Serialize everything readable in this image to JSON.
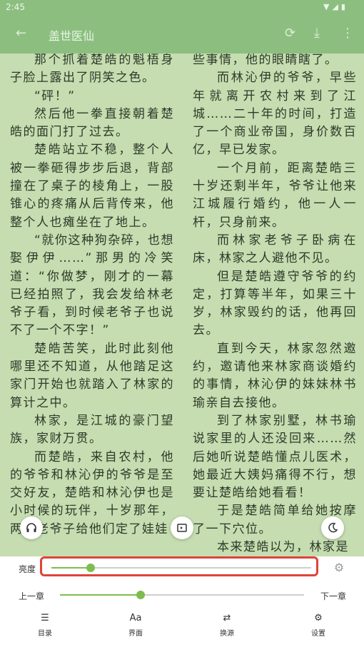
{
  "status": {
    "time": "2:45"
  },
  "topbar": {
    "back_icon": "back-arrow-icon",
    "title": "盖世医仙",
    "refresh_icon": "refresh-icon",
    "download_icon": "download-icon",
    "more_icon": "more-vert-icon"
  },
  "content": {
    "left_paragraphs": [
      {
        "text": "那个抓着楚皓的魁梧身子脸上露出了阴笑之色。",
        "indent": true
      },
      {
        "text": "“砰！”",
        "indent": true
      },
      {
        "text": "然后他一拳直接朝着楚皓的面门打了过去。",
        "indent": true
      },
      {
        "text": "楚皓站立不稳，整个人被一拳砸得步步后退，背部撞在了桌子的棱角上，一股锥心的疼痛从后背传来，他整个人也瘫坐在了地上。",
        "indent": true
      },
      {
        "text": "“就你这种狗杂碎，也想娶伊伊……”那男的冷笑道：“你做梦，刚才的一幕已经拍照了，我会发给林老爷子看，到时候老爷子也说不了一个不字！”",
        "indent": true
      },
      {
        "text": "楚皓苦笑，此时此刻他哪里还不知道，从他踏足这家门开始也就踏入了林家的算计之中。",
        "indent": true
      },
      {
        "text": "林家，是江城的豪门望族，家财万贯。",
        "indent": true
      },
      {
        "text": "而楚皓，来自农村，他的爷爷和林沁伊的爷爷是至交好友，楚皓和林沁伊也是小时候的玩伴，十岁那年，两个老爷子给他们定了娃娃",
        "indent": true
      }
    ],
    "right_paragraphs": [
      {
        "text": "些事情，他的眼睛瞎了。",
        "indent": false
      },
      {
        "text": "而林沁伊的爷爷，早些年就离开农村来到了江城……二十年的时间，打造了一个商业帝国，身价数百亿，早已发家。",
        "indent": true
      },
      {
        "text": "一个月前，距离楚皓三十岁还剩半年，爷爷让他来江城履行婚约，他一人一杆，只身前来。",
        "indent": true
      },
      {
        "text": "而林家老爷子卧病在床，林家之人避他不见。",
        "indent": true
      },
      {
        "text": "但是楚皓遵守爷爷的约定，打算等半年，如果三十岁，林家毁约的话，他再回去。",
        "indent": true
      },
      {
        "text": "直到今天，林家忽然邀约，邀请他来林家商谈婚约的事情，林沁伊的妹妹林书瑜亲自去接他。",
        "indent": true
      },
      {
        "text": "到了林家别墅，林书瑜说家里的人还没回来……然后她听说楚皓懂点儿医术，她最近大姨妈痛得不行，想要让楚皓给她看看！",
        "indent": true
      },
      {
        "text": "于是楚皓简单给她按摩了一下穴位。",
        "indent": true
      },
      {
        "text": "本来楚皓以为，林家是",
        "indent": true
      }
    ]
  },
  "fabs": {
    "listen_icon": "headphones-icon",
    "autopage_icon": "auto-page-icon",
    "night_icon": "moon-icon"
  },
  "settings": {
    "brightness_label": "亮度",
    "brightness_value": 0.15,
    "brightness_auto_icon": "auto-brightness-icon",
    "prev_chapter_label": "上一章",
    "next_chapter_label": "下一章",
    "chapter_progress": 0.33
  },
  "bottom_nav": [
    {
      "label": "目录",
      "icon": "toc-icon"
    },
    {
      "label": "界面",
      "icon": "font-icon"
    },
    {
      "label": "换源",
      "icon": "switch-source-icon"
    },
    {
      "label": "设置",
      "icon": "gear-icon"
    }
  ],
  "colors": {
    "reader_bg": "#c5ddb0",
    "accent": "#7dbd4e",
    "highlight": "#e0433a"
  }
}
